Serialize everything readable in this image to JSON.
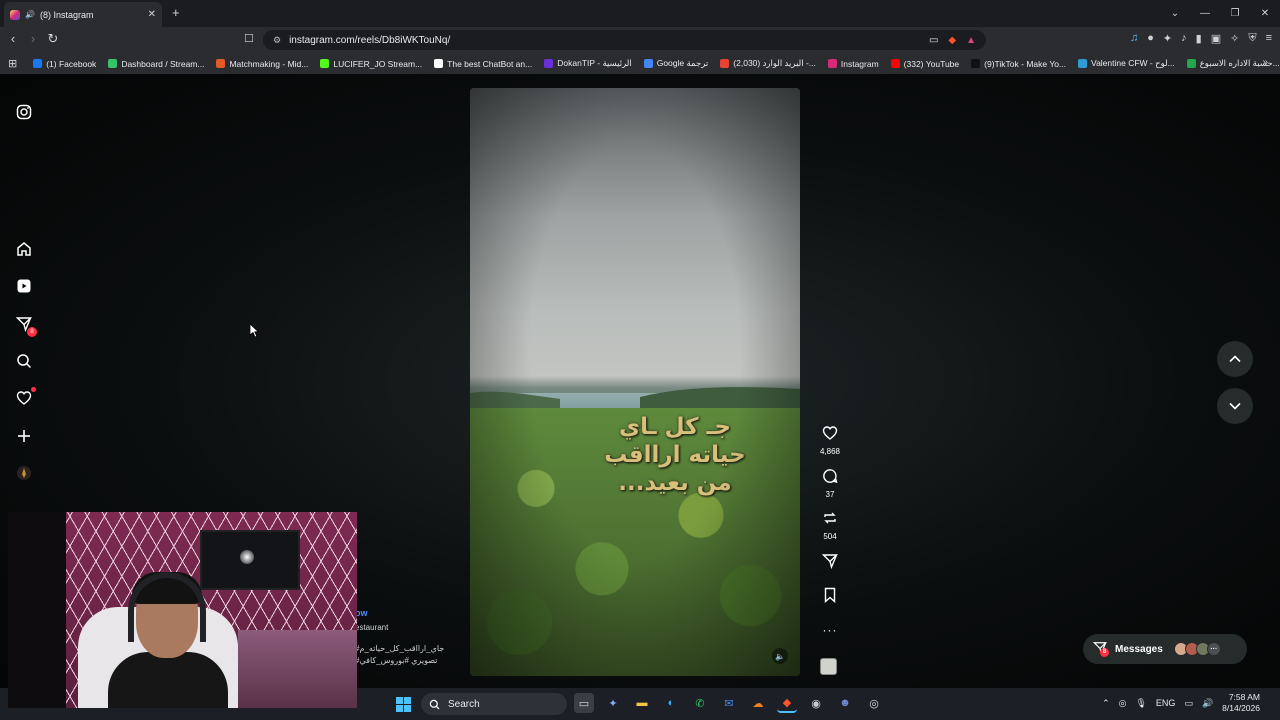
{
  "browser": {
    "tab_title": "(8) Instagram",
    "url": "instagram.com/reels/Db8iWKTouNq/",
    "bookmarks": [
      {
        "label": "(1) Facebook",
        "color": "#1877f2"
      },
      {
        "label": "Dashboard / Stream...",
        "color": "#36c36a"
      },
      {
        "label": "Matchmaking - Mid...",
        "color": "#e05a2a"
      },
      {
        "label": "LUCIFER_JO Stream...",
        "color": "#53fc18"
      },
      {
        "label": "The best ChatBot an...",
        "color": "#ffffff"
      },
      {
        "label": "DokanTIP - الرئيسية",
        "color": "#6a2fd6"
      },
      {
        "label": "Google ترجمة",
        "color": "#4285f4"
      },
      {
        "label": "البريد الوارد (2,030) -...",
        "color": "#ea4335"
      },
      {
        "label": "Instagram",
        "color": "#d62976"
      },
      {
        "label": "(332) YouTube",
        "color": "#ff0000"
      },
      {
        "label": "(9)TikTok - Make Yo...",
        "color": "#111111"
      },
      {
        "label": "Valentine CFW - لوح...",
        "color": "#2f9bd6"
      },
      {
        "label": "حسبة الاداره الاسبوع...",
        "color": "#22a84a"
      }
    ]
  },
  "reel": {
    "overlay_line1": "جـ كل ـاي",
    "overlay_line2": "حياته ارااقب",
    "overlay_line3": "من بعيد...",
    "likes": "4,868",
    "comments": "37",
    "reposts": "504"
  },
  "caption": {
    "follow": "ow",
    "location": "estaurant",
    "hashtags1": "#جاي_ارااقب_كل_حياته_م",
    "hashtags2": "#تصويري #بوروس_كافي"
  },
  "messages": {
    "label": "Messages",
    "badge": "8"
  },
  "sidebar": {
    "notifications_badge": "8"
  },
  "taskbar": {
    "search_label": "Search",
    "language": "ENG",
    "time": "7:58 AM",
    "date": "8/14/2026"
  }
}
